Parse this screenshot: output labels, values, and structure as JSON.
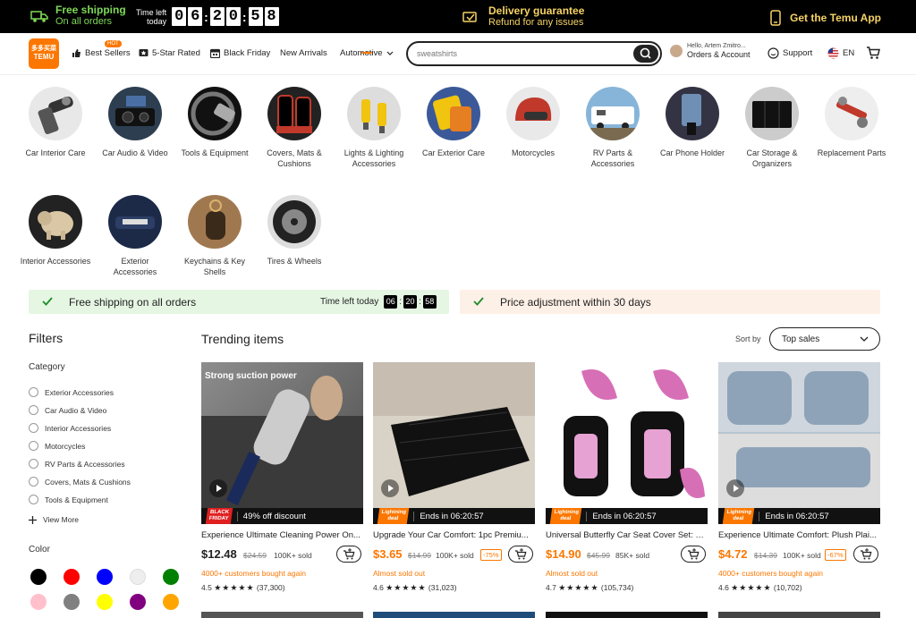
{
  "topbar": {
    "shipping_line1": "Free shipping",
    "shipping_line2": "On all orders",
    "timer_label_1": "Time left",
    "timer_label_2": "today",
    "timer": [
      "0",
      "6",
      "2",
      "0",
      "5",
      "8"
    ],
    "delivery_line1": "Delivery guarantee",
    "delivery_line2": "Refund for any issues",
    "app_label": "Get the Temu App"
  },
  "header": {
    "logo_top": "多多买菜",
    "logo_bottom": "TEMU",
    "hot_badge": "HOT",
    "nav": [
      "Best Sellers",
      "5-Star Rated",
      "Black Friday",
      "New Arrivals",
      "Automotive"
    ],
    "search_value": "sweatshirts",
    "account_line1": "Hello, Artem Zmitro...",
    "account_line2": "Orders & Account",
    "support": "Support",
    "language": "EN"
  },
  "categories": [
    {
      "label": "Car Interior Care"
    },
    {
      "label": "Car Audio & Video"
    },
    {
      "label": "Tools & Equipment"
    },
    {
      "label": "Covers, Mats & Cushions"
    },
    {
      "label": "Lights & Lighting Accessories"
    },
    {
      "label": "Car Exterior Care"
    },
    {
      "label": "Motorcycles"
    },
    {
      "label": "RV Parts & Accessories"
    },
    {
      "label": "Car Phone Holder"
    },
    {
      "label": "Car Storage & Organizers"
    },
    {
      "label": "Replacement Parts"
    },
    {
      "label": "Interior Accessories"
    },
    {
      "label": "Exterior Accessories"
    },
    {
      "label": "Keychains & Key Shells"
    },
    {
      "label": "Tires & Wheels"
    }
  ],
  "strips": {
    "free_shipping": "Free shipping on all orders",
    "time_left": "Time left today",
    "timer": [
      "06",
      "20",
      "58"
    ],
    "price_adjust": "Price adjustment within 30 days"
  },
  "filters": {
    "title": "Filters",
    "category_title": "Category",
    "category_options": [
      "Exterior Accessories",
      "Car Audio & Video",
      "Interior Accessories",
      "Motorcycles",
      "RV Parts & Accessories",
      "Covers, Mats & Cushions",
      "Tools & Equipment"
    ],
    "view_more": "View More",
    "color_title": "Color",
    "colors": [
      "#000000",
      "#ff0000",
      "#0000ff",
      "#eeeeee",
      "#008000",
      "#ffc0cb",
      "#808080",
      "#ffff00",
      "#800080",
      "#ffa500"
    ]
  },
  "trending": {
    "title": "Trending items",
    "sort_label": "Sort by",
    "sort_value": "Top sales"
  },
  "products": [
    {
      "img_text": "Strong suction power",
      "badge_line1": "BLACK",
      "badge_line2": "FRIDAY",
      "deal_text": "49% off discount",
      "title": "Experience Ultimate Cleaning Power On...",
      "price": "$12.48",
      "old_price": "$24.59",
      "sold": "100K+ sold",
      "pct": "",
      "social": "4000+ customers bought again",
      "rating": "4.5",
      "stars": "★★★★★",
      "reviews": "(37,300)"
    },
    {
      "img_text": "",
      "badge_line1": "Lightning",
      "badge_line2": "deal",
      "deal_text": "Ends in 06:20:57",
      "title": "Upgrade Your Car Comfort: 1pc Premiu...",
      "price": "$3.65",
      "old_price": "$14.99",
      "sold": "100K+ sold",
      "pct": "-75%",
      "social": "Almost sold out",
      "rating": "4.6",
      "stars": "★★★★★",
      "reviews": "(31,023)"
    },
    {
      "img_text": "",
      "badge_line1": "Lightning",
      "badge_line2": "deal",
      "deal_text": "Ends in 06:20:57",
      "title": "Universal Butterfly Car Seat Cover Set: S...",
      "price": "$14.90",
      "old_price": "$45.99",
      "sold": "85K+ sold",
      "pct": "",
      "social": "Almost sold out",
      "rating": "4.7",
      "stars": "★★★★★",
      "reviews": "(105,734)"
    },
    {
      "img_text": "",
      "badge_line1": "Lightning",
      "badge_line2": "deal",
      "deal_text": "Ends in 06:20:57",
      "title": "Experience Ultimate Comfort: Plush Plai...",
      "price": "$4.72",
      "old_price": "$14.39",
      "sold": "100K+ sold",
      "pct": "-67%",
      "social": "4000+ customers bought again",
      "rating": "4.6",
      "stars": "★★★★★",
      "reviews": "(10,702)"
    }
  ]
}
